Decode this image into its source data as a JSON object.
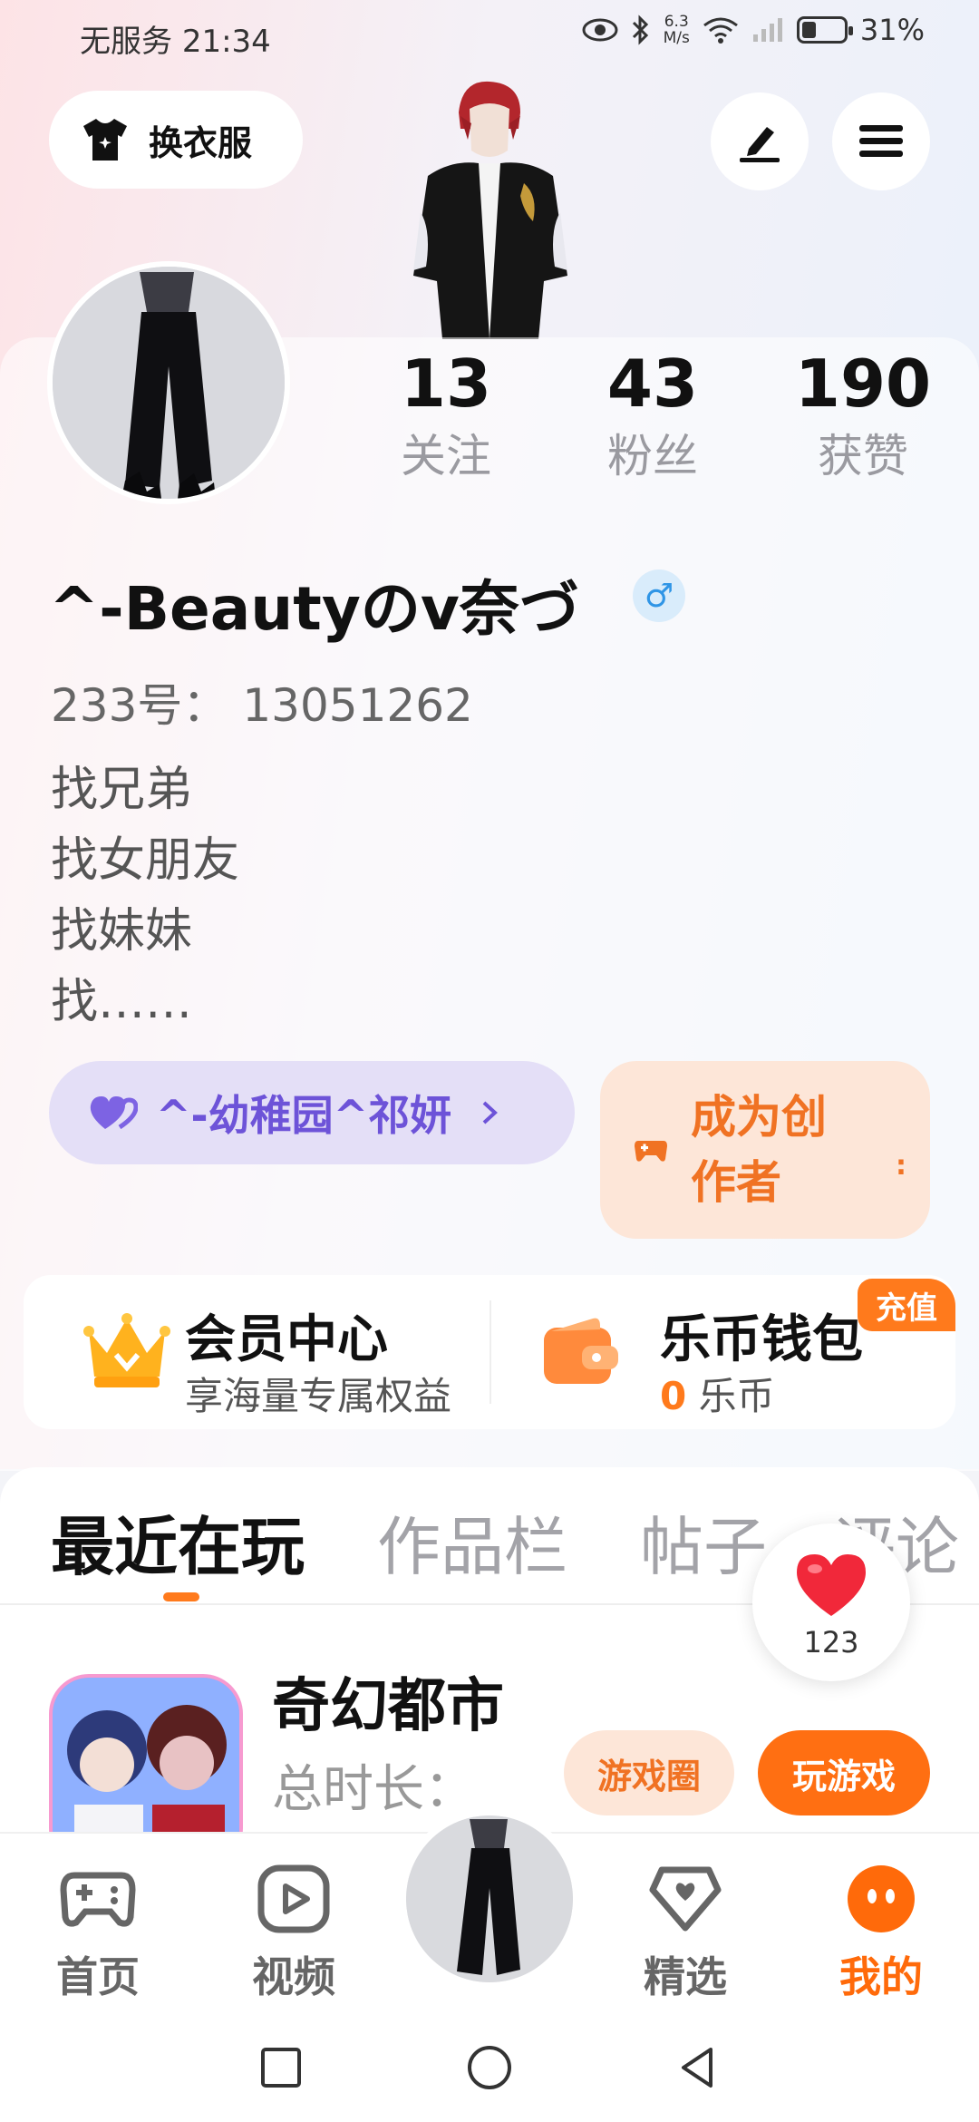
{
  "status_bar": {
    "carrier": "无服务",
    "time": "21:34",
    "net_speed": "6.3",
    "net_unit": "M/s",
    "battery": "31%",
    "battery_level": 0.31
  },
  "header": {
    "outfit_label": "换衣服"
  },
  "profile": {
    "stats": [
      {
        "value": "13",
        "label": "关注"
      },
      {
        "value": "43",
        "label": "粉丝"
      },
      {
        "value": "190",
        "label": "获赞"
      }
    ],
    "nickname": "^-Beautyのv奈づ",
    "gender_symbol": "♂",
    "uid": "233号：  13051262",
    "bio": [
      "找兄弟",
      "找女朋友",
      "找妹妹",
      "找……"
    ],
    "guild": "^-幼稚园^祁妍",
    "creator_line1": "成为创",
    "creator_line2": "作者"
  },
  "vip": {
    "member_title": "会员中心",
    "member_sub": "享海量专属权益",
    "wallet_title": "乐币钱包",
    "wallet_amount": "0",
    "wallet_unit": " 乐币",
    "recharge": "充值"
  },
  "tabs": [
    "最近在玩",
    "作品栏",
    "帖子",
    "评论"
  ],
  "likes": {
    "count": "123"
  },
  "recent_game": {
    "name": "奇幻都市",
    "time_label": "总时长：",
    "circle_button": "游戏圈",
    "play_button": "玩游戏"
  },
  "bottom_nav": [
    {
      "label": "首页",
      "icon": "gamepad-icon"
    },
    {
      "label": "视频",
      "icon": "video-icon"
    },
    {
      "label": "精选",
      "icon": "heart-badge-icon"
    },
    {
      "label": "我的",
      "icon": "face-icon"
    }
  ],
  "colors": {
    "accent": "#ff6f12",
    "guild": "#6d53d8",
    "gender": "#2f95e6"
  }
}
